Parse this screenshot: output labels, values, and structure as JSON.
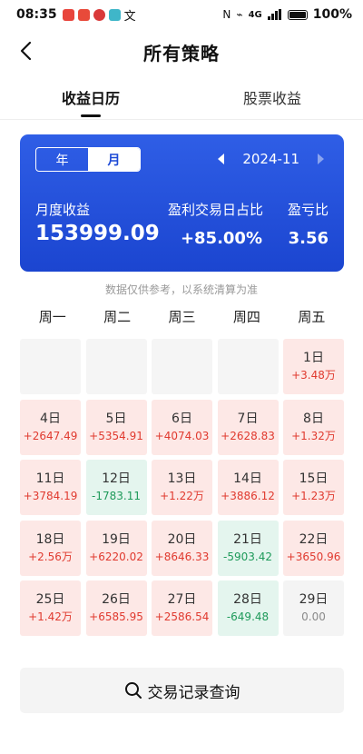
{
  "status": {
    "time": "08:35",
    "network": "4G",
    "battery": "100%"
  },
  "header": {
    "title": "所有策略"
  },
  "tabs": [
    {
      "label": "收益日历",
      "active": true
    },
    {
      "label": "股票收益",
      "active": false
    }
  ],
  "card": {
    "seg_year": "年",
    "seg_month": "月",
    "month": "2024-11",
    "monthly_label": "月度收益",
    "monthly_value": "153999.09",
    "winrate_label": "盈利交易日占比",
    "winrate_value": "+85.00%",
    "pl_label": "盈亏比",
    "pl_value": "3.56"
  },
  "note": "数据仅供参考，以系统清算为准",
  "weekdays": [
    "周一",
    "周二",
    "周三",
    "周四",
    "周五"
  ],
  "days": [
    {
      "day": "",
      "value": "",
      "kind": "empty"
    },
    {
      "day": "",
      "value": "",
      "kind": "empty"
    },
    {
      "day": "",
      "value": "",
      "kind": "empty"
    },
    {
      "day": "",
      "value": "",
      "kind": "empty"
    },
    {
      "day": "1日",
      "value": "+3.48万",
      "kind": "pos"
    },
    {
      "day": "4日",
      "value": "+2647.49",
      "kind": "pos"
    },
    {
      "day": "5日",
      "value": "+5354.91",
      "kind": "pos"
    },
    {
      "day": "6日",
      "value": "+4074.03",
      "kind": "pos"
    },
    {
      "day": "7日",
      "value": "+2628.83",
      "kind": "pos"
    },
    {
      "day": "8日",
      "value": "+1.32万",
      "kind": "pos"
    },
    {
      "day": "11日",
      "value": "+3784.19",
      "kind": "pos"
    },
    {
      "day": "12日",
      "value": "-1783.11",
      "kind": "neg"
    },
    {
      "day": "13日",
      "value": "+1.22万",
      "kind": "pos"
    },
    {
      "day": "14日",
      "value": "+3886.12",
      "kind": "pos"
    },
    {
      "day": "15日",
      "value": "+1.23万",
      "kind": "pos"
    },
    {
      "day": "18日",
      "value": "+2.56万",
      "kind": "pos"
    },
    {
      "day": "19日",
      "value": "+6220.02",
      "kind": "pos"
    },
    {
      "day": "20日",
      "value": "+8646.33",
      "kind": "pos"
    },
    {
      "day": "21日",
      "value": "-5903.42",
      "kind": "neg"
    },
    {
      "day": "22日",
      "value": "+3650.96",
      "kind": "pos"
    },
    {
      "day": "25日",
      "value": "+1.42万",
      "kind": "pos"
    },
    {
      "day": "26日",
      "value": "+6585.95",
      "kind": "pos"
    },
    {
      "day": "27日",
      "value": "+2586.54",
      "kind": "pos"
    },
    {
      "day": "28日",
      "value": "-649.48",
      "kind": "neg"
    },
    {
      "day": "29日",
      "value": "0.00",
      "kind": "zero"
    }
  ],
  "query_button": "交易记录查询",
  "colors": {
    "card_blue": "#1d4ad6",
    "profit_red": "#e03a2f",
    "loss_green": "#1e9a5a"
  }
}
